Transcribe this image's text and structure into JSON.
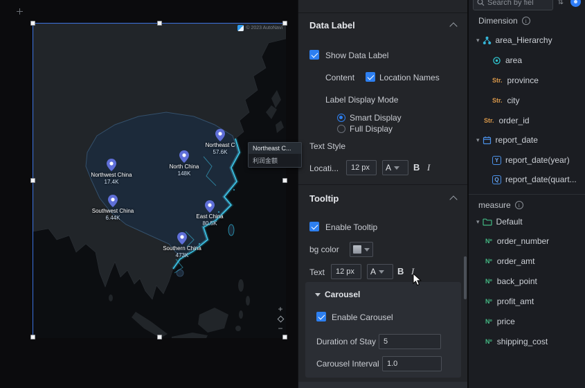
{
  "map": {
    "watermark": "© 2023 AutoNavi",
    "tooltip": {
      "title": "Northeast C...",
      "row_label": "利润金额"
    },
    "labels": [
      {
        "name": "Northeast C",
        "value": "57.6K"
      },
      {
        "name": "North China",
        "value": "148K"
      },
      {
        "name": "Northwest China",
        "value": "17.4K"
      },
      {
        "name": "Southwest China",
        "value": "6.44K"
      },
      {
        "name": "East China",
        "value": "80.5K"
      },
      {
        "name": "Southern China",
        "value": "473K"
      }
    ],
    "controls": {
      "zoom_in": "+",
      "zoom_out": "−"
    }
  },
  "settings": {
    "data_label": {
      "title": "Data Label",
      "show_label": "Show Data Label",
      "show_label_checked": true,
      "content_label": "Content",
      "location_names": "Location Names",
      "location_names_checked": true,
      "display_mode_label": "Label Display Mode",
      "smart": "Smart Display",
      "smart_selected": true,
      "full": "Full Display",
      "text_style": "Text Style",
      "location_field": "Locati...",
      "font_size": "12 px",
      "color_a": "A",
      "bold": "B",
      "italic": "I"
    },
    "tooltip": {
      "title": "Tooltip",
      "enable": "Enable Tooltip",
      "enable_checked": true,
      "bg_color_label": "bg color",
      "text_label": "Text",
      "font_size": "12 px",
      "color_a": "A",
      "bold": "B",
      "italic": "I",
      "carousel": {
        "title": "Carousel",
        "enable": "Enable Carousel",
        "enable_checked": true,
        "duration_label": "Duration of Stay",
        "duration_value": "5",
        "interval_label": "Carousel Interval",
        "interval_value": "1.0"
      }
    }
  },
  "fields": {
    "search_placeholder": "Search by fiel",
    "dimension_title": "Dimension",
    "dimension": [
      {
        "label": "area_Hierarchy",
        "icon": "hierarchy-icon"
      },
      {
        "label": "area",
        "icon": "geo-icon"
      },
      {
        "label": "province",
        "icon_text": "Str."
      },
      {
        "label": "city",
        "icon_text": "Str."
      },
      {
        "label": "order_id",
        "icon_text": "Str."
      },
      {
        "label": "report_date",
        "icon": "calendar-icon"
      },
      {
        "label": "report_date(year)",
        "icon_text": "Y"
      },
      {
        "label": "report_date(quart...",
        "icon_text": "Q"
      }
    ],
    "measure_title": "measure",
    "measure_group": "Default",
    "measure": [
      {
        "label": "order_number",
        "icon_text": "Nº"
      },
      {
        "label": "order_amt",
        "icon_text": "Nº"
      },
      {
        "label": "back_point",
        "icon_text": "Nº"
      },
      {
        "label": "profit_amt",
        "icon_text": "Nº"
      },
      {
        "label": "price",
        "icon_text": "Nº"
      },
      {
        "label": "shipping_cost",
        "icon_text": "Nº"
      }
    ]
  }
}
